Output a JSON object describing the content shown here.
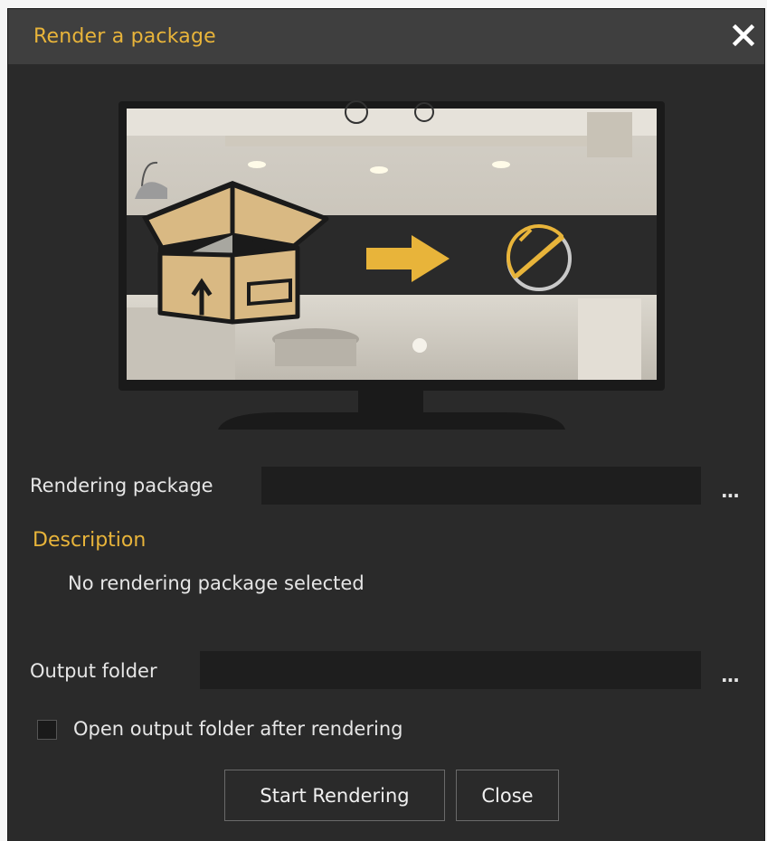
{
  "dialog": {
    "title": "Render a package",
    "close_icon": "close-icon"
  },
  "hero": {
    "description": "",
    "icons": [
      "package-box-icon",
      "arrow-right-icon",
      "render-circle-icon",
      "monitor-icon"
    ],
    "colors": {
      "accent": "#e8b43a",
      "box": "#d9b983",
      "box_dark": "#a8895a",
      "band": "#2a2a2a",
      "screen_bg": "#dcd8cf"
    }
  },
  "rendering_package": {
    "label": "Rendering package",
    "value": "",
    "browse_label": "..."
  },
  "description_section": {
    "title": "Description",
    "text": "No rendering package selected"
  },
  "output_folder": {
    "label": "Output folder",
    "value": "",
    "browse_label": "..."
  },
  "open_after": {
    "label": "Open output folder after rendering",
    "checked": false
  },
  "buttons": {
    "start_label": "Start Rendering",
    "close_label": "Close"
  },
  "colors": {
    "title_accent": "#e8b43a",
    "dialog_bg": "#2a2a2a",
    "titlebar_bg": "#3f3f3f",
    "field_bg": "#1e1e1e",
    "text": "#e6e6e6"
  }
}
